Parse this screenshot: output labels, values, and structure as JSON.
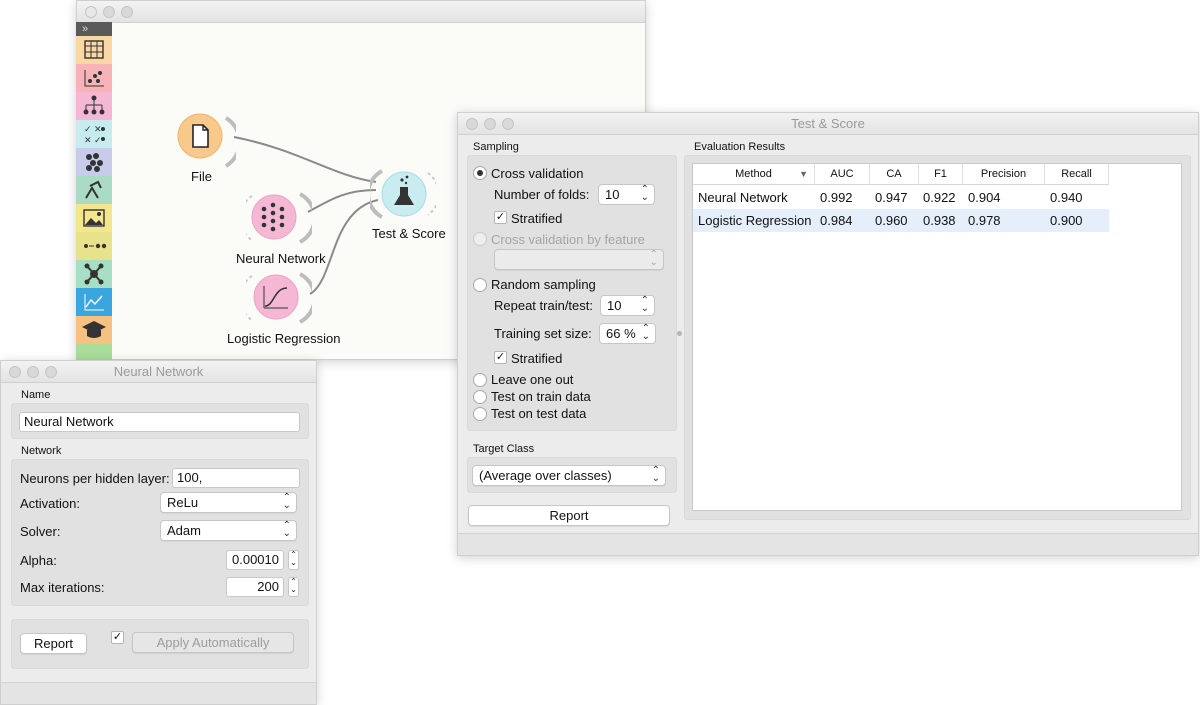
{
  "canvas": {
    "widgets": {
      "file": "File",
      "neural_network": "Neural Network",
      "logistic_regression": "Logistic Regression",
      "test_score": "Test & Score"
    },
    "toolbar_expand": "»"
  },
  "nn_window": {
    "title": "Neural Network",
    "name_group": "Name",
    "name_value": "Neural Network",
    "network_group": "Network",
    "neurons_label": "Neurons per hidden layer:",
    "neurons_value": "100,",
    "activation_label": "Activation:",
    "activation_value": "ReLu",
    "solver_label": "Solver:",
    "solver_value": "Adam",
    "alpha_label": "Alpha:",
    "alpha_value": "0.00010",
    "max_iter_label": "Max iterations:",
    "max_iter_value": "200",
    "report": "Report",
    "apply_auto": "Apply Automatically",
    "apply_checked": "✓"
  },
  "ts_window": {
    "title": "Test & Score",
    "sampling_group": "Sampling",
    "cross_validation": "Cross validation",
    "folds_label": "Number of folds:",
    "folds_value": "10",
    "stratified": "Stratified",
    "check": "✓",
    "cv_by_feature": "Cross validation by feature",
    "random_sampling": "Random sampling",
    "repeat_label": "Repeat train/test:",
    "repeat_value": "10",
    "train_size_label": "Training set size:",
    "train_size_value": "66 %",
    "stratified2": "Stratified",
    "leave_one_out": "Leave one out",
    "test_on_train": "Test on train data",
    "test_on_test": "Test on test data",
    "target_group": "Target Class",
    "target_value": "(Average over classes)",
    "report": "Report",
    "results_group": "Evaluation Results",
    "columns": [
      "Method",
      "AUC",
      "CA",
      "F1",
      "Precision",
      "Recall"
    ],
    "rows": [
      [
        "Neural Network",
        "0.992",
        "0.947",
        "0.922",
        "0.904",
        "0.940"
      ],
      [
        "Logistic Regression",
        "0.984",
        "0.960",
        "0.938",
        "0.978",
        "0.900"
      ]
    ],
    "sort_indicator": "▼"
  },
  "colors": {
    "file": "#f7c98b",
    "neural_network": "#f5b8d4",
    "logistic_regression": "#f5b8d4",
    "test_score": "#c9ecf1",
    "selected_row": "#e5eefb"
  }
}
